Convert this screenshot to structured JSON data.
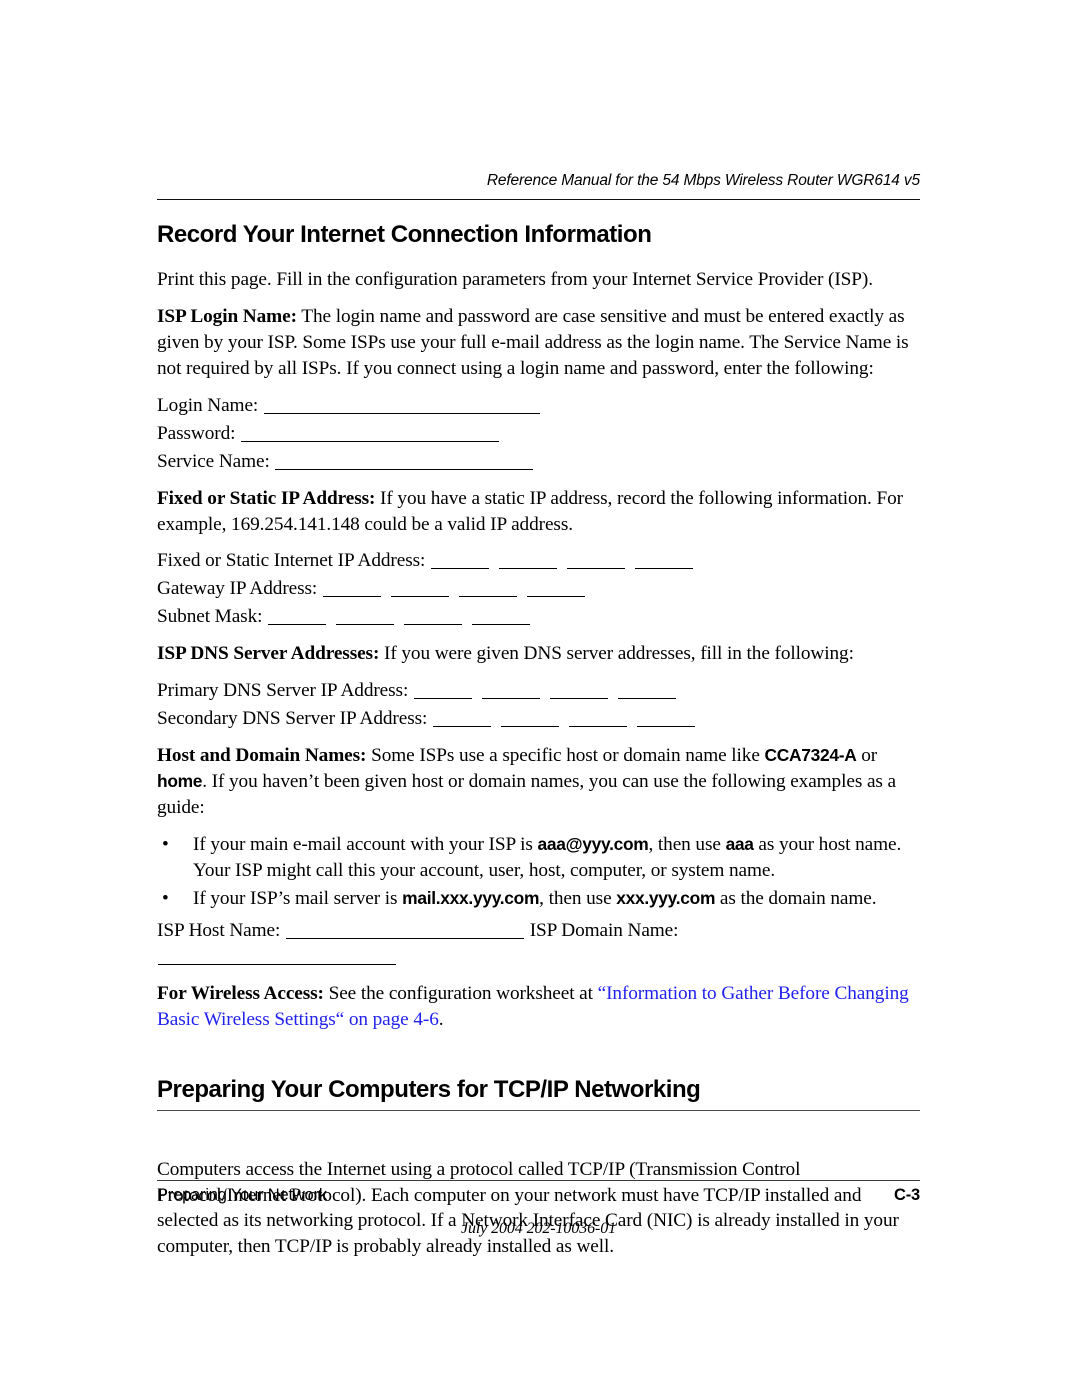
{
  "header": {
    "running_head": "Reference Manual for the 54 Mbps Wireless Router WGR614 v5"
  },
  "section1": {
    "title": "Record Your Internet Connection Information",
    "intro": "Print this page. Fill in the configuration parameters from your Internet Service Provider (ISP).",
    "isp_login": {
      "label": "ISP Login Name:",
      "text": " The login name and password are case sensitive and must be entered exactly as given by your ISP. Some ISPs use your full e-mail address as the login name. The Service Name is not required by all ISPs. If you connect using a login name and password, enter the following:"
    },
    "fields": [
      {
        "label": "Login Name:"
      },
      {
        "label": "Password:"
      },
      {
        "label": "Service Name:"
      }
    ],
    "static_ip": {
      "label": "Fixed or Static IP Address:",
      "text": " If you have a static IP address, record the following information. For example, 169.254.141.148 could be a valid IP address."
    },
    "ip_fields": [
      {
        "label": "Fixed or Static Internet IP Address:"
      },
      {
        "label": "Gateway IP Address:"
      },
      {
        "label": "Subnet Mask:"
      }
    ],
    "dns": {
      "label": "ISP DNS Server Addresses:",
      "text": " If you were given DNS server addresses, fill in the following:"
    },
    "dns_fields": [
      {
        "label": "Primary DNS Server IP Address:"
      },
      {
        "label": "Secondary DNS Server IP Address:"
      }
    ],
    "host_domain": {
      "label": "Host and Domain Names:",
      "text_a": " Some ISPs use a specific host or domain name like ",
      "example_a": "CCA7324-A",
      "text_b": " or ",
      "example_b": "home",
      "text_c": ". If you haven’t been given host or domain names, you can use the following examples as a guide:"
    },
    "bullets": [
      {
        "bullet": "•",
        "part1": "If your main e-mail account with your ISP is ",
        "code1": "aaa@yyy.com",
        "part2": ", then use ",
        "code2": "aaa",
        "part3": " as your host name. Your ISP might call this your account, user, host, computer, or system name."
      },
      {
        "bullet": "•",
        "part1": "If your ISP’s mail server is ",
        "code1": "mail.xxx.yyy.com",
        "part2": ", then use ",
        "code2": "xxx.yyy.com",
        "part3": " as the domain name."
      }
    ],
    "name_fields": {
      "host_label": "ISP Host Name:",
      "domain_label": "ISP Domain Name:"
    },
    "wireless": {
      "label": "For Wireless Access:",
      "text": " See the configuration worksheet at ",
      "link_text": "“Information to Gather Before Changing Basic Wireless Settings“ on page 4-6",
      "trailing": "."
    }
  },
  "section2": {
    "title": "Preparing Your Computers for TCP/IP Networking",
    "paragraph": "Computers access the Internet using a protocol called TCP/IP (Transmission Control Protocol/Internet Protocol). Each computer on your network must have TCP/IP installed and selected as its networking protocol. If a Network Interface Card (NIC) is already installed in your computer, then TCP/IP is probably already installed as well."
  },
  "footer": {
    "left": "Preparing Your Network",
    "right": "C-3",
    "document_id": "July 2004 202-10036-01"
  },
  "colors": {
    "link": "#2222ee",
    "text": "#000000",
    "rule": "#3a3a3a",
    "background": "#ffffff"
  }
}
